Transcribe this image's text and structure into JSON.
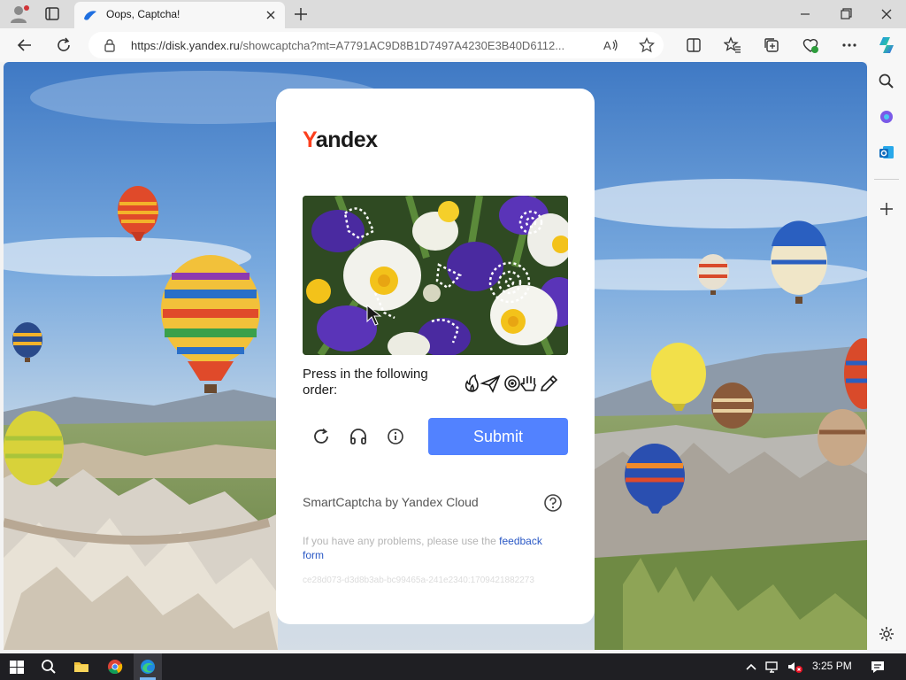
{
  "browser": {
    "tab_title": "Oops, Captcha!",
    "url_host": "https://disk.yandex.ru",
    "url_rest": "/showcaptcha?mt=A7791AC9D8B1D7497A4230E3B40D6112..."
  },
  "captcha": {
    "logo_first": "Y",
    "logo_rest": "andex",
    "instruction": "Press in the following order:",
    "order_icon_names": [
      "flame-icon",
      "paper-plane-icon",
      "target-icon",
      "hand-icon",
      "pencil-icon"
    ],
    "submit_label": "Submit",
    "provider": "SmartCaptcha by Yandex Cloud",
    "problems_text": "If you have any problems, please use the ",
    "feedback_link": "feedback form",
    "token": "ce28d073-d3d8b3ab-bc99465a-241e2340:1709421882273",
    "accent_color": "#5282ff",
    "logo_color": "#fc3f1d"
  },
  "taskbar": {
    "time": "3:25 PM"
  }
}
